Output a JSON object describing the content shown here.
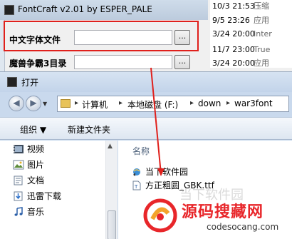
{
  "background_list": [
    {
      "date": "10/3 21:53",
      "type": "压缩"
    },
    {
      "date": "9/5 23:26",
      "type": "应用"
    },
    {
      "date": "3/24 20:00",
      "type": "Inter"
    },
    {
      "date": "11/7 23:00",
      "type": "True"
    },
    {
      "date": "3/24 20:00",
      "type": "应用"
    }
  ],
  "fontcraft": {
    "title": "FontCraft v2.01 by ESPER_PALE",
    "cn_font_label": "中文字体文件",
    "browse_label": "...",
    "war3_dir_label": "魔兽争霸3目录",
    "cn_font_value": "",
    "war3_dir_value": ""
  },
  "dialog": {
    "title": "打开",
    "breadcrumb": [
      "计算机",
      "本地磁盘 (F:)",
      "down",
      "war3font"
    ],
    "toolbar": {
      "organize": "组织 ▼",
      "new_folder": "新建文件夹"
    },
    "nav_items": [
      {
        "label": "视频",
        "icon": "video-icon"
      },
      {
        "label": "图片",
        "icon": "picture-icon"
      },
      {
        "label": "文档",
        "icon": "document-icon"
      },
      {
        "label": "迅雷下载",
        "icon": "download-icon"
      },
      {
        "label": "音乐",
        "icon": "music-icon"
      }
    ],
    "column_name": "名称",
    "files": [
      {
        "label": "当下软件园",
        "icon": "internet-shortcut-icon"
      },
      {
        "label": "方正粗圆_GBK.ttf",
        "icon": "font-file-icon"
      }
    ]
  },
  "watermark": {
    "brand_cn": "源码搜藏网",
    "brand_en": "codesocang.com",
    "faint": "当下软件园"
  },
  "colors": {
    "highlight": "#e0201c",
    "watermark_red": "#e8262a"
  }
}
